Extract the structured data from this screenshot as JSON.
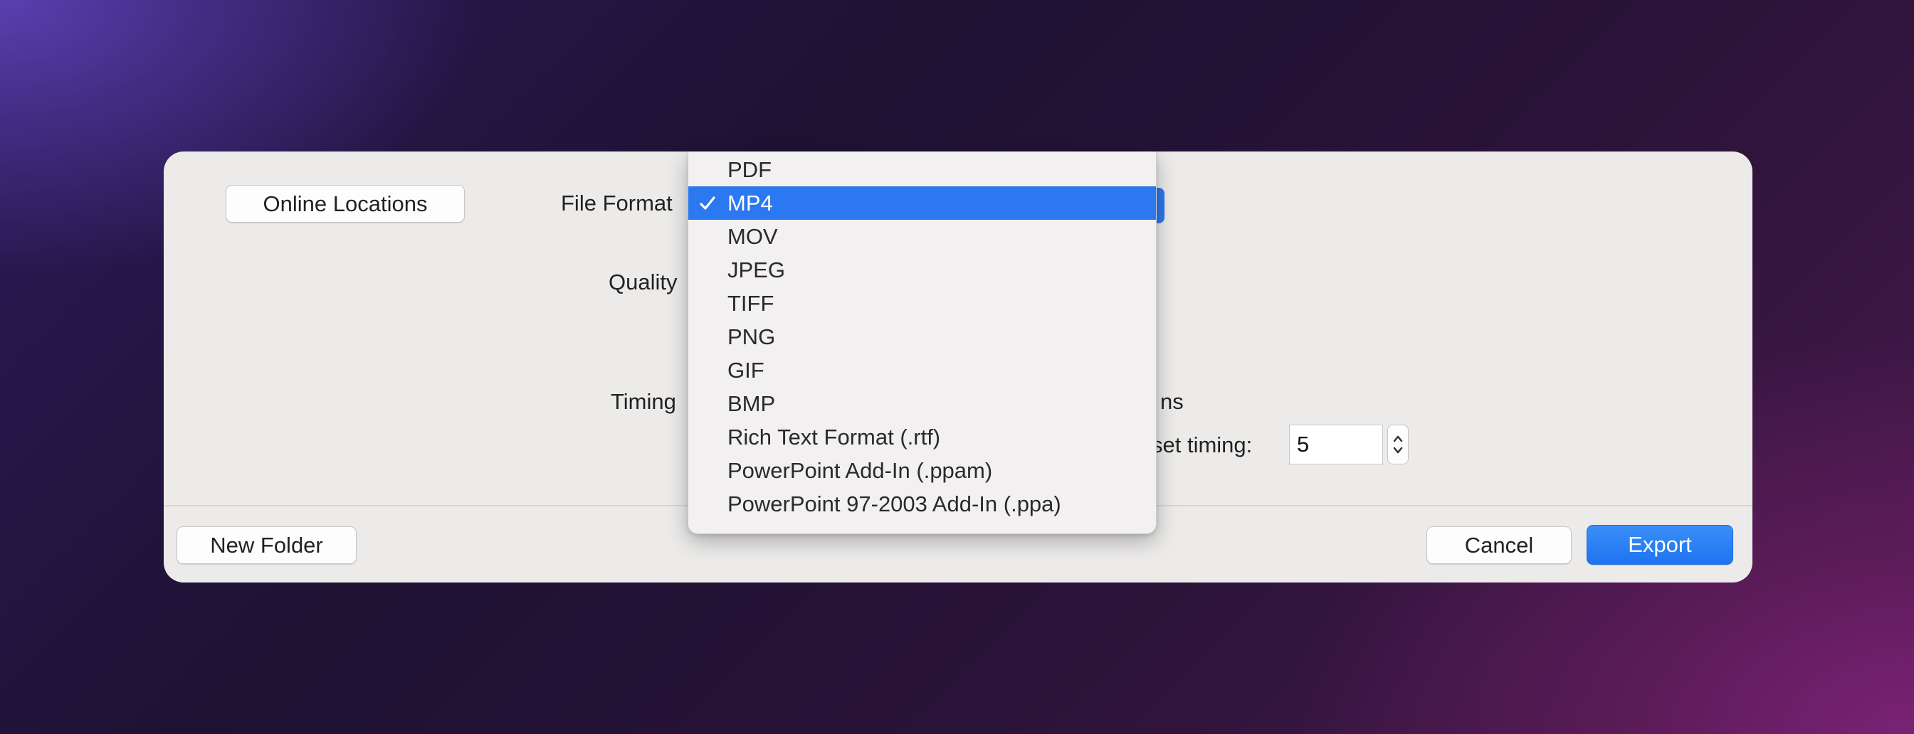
{
  "dialog": {
    "online_locations": "Online Locations",
    "file_format_label": "File Format",
    "quality_label": "Quality",
    "timing_label": "Timing",
    "timing_suffix_fragment": "ns",
    "preset_timing_fragment": "set timing:",
    "preset_timing_value": "5",
    "new_folder": "New Folder",
    "cancel": "Cancel",
    "export": "Export"
  },
  "format_menu": {
    "selected": "MP4",
    "items": [
      "PDF",
      "MP4",
      "MOV",
      "JPEG",
      "TIFF",
      "PNG",
      "GIF",
      "BMP",
      "Rich Text Format (.rtf)",
      "PowerPoint Add-In (.ppam)",
      "PowerPoint 97-2003 Add-In (.ppa)"
    ]
  },
  "colors": {
    "accent": "#2b78f0",
    "dialog_bg": "#ecebea"
  }
}
